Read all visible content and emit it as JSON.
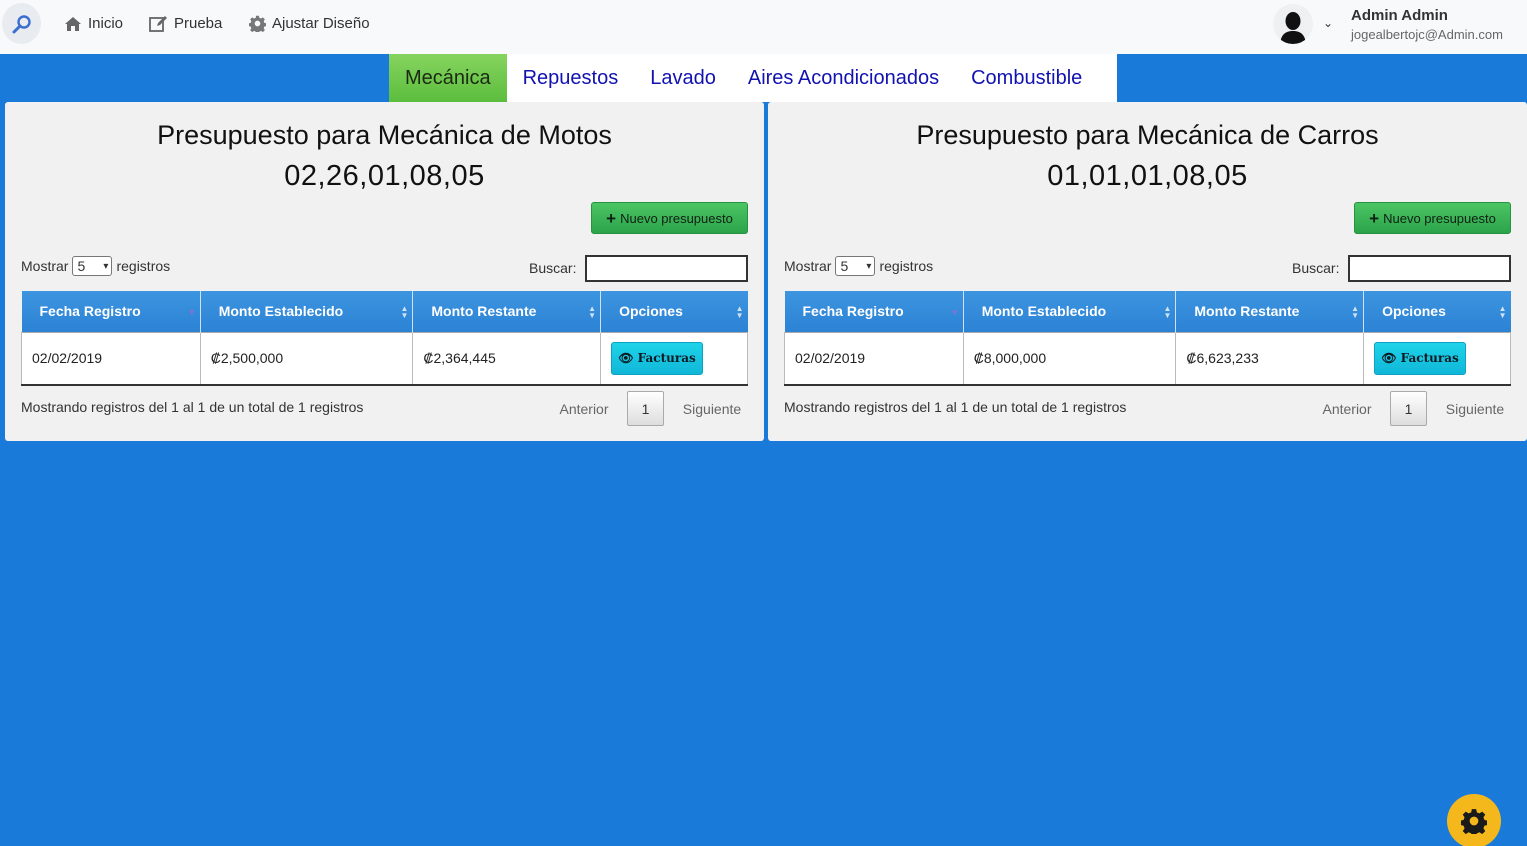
{
  "nav": {
    "items": [
      {
        "label": "Inicio",
        "icon": "home-icon"
      },
      {
        "label": "Prueba",
        "icon": "edit-icon"
      },
      {
        "label": "Ajustar Diseño",
        "icon": "gear-icon"
      }
    ]
  },
  "user": {
    "name": "Admin Admin",
    "email": "jogealbertojc@Admin.com"
  },
  "tabs": [
    {
      "label": "Mecánica",
      "active": true
    },
    {
      "label": "Repuestos",
      "active": false
    },
    {
      "label": "Lavado",
      "active": false
    },
    {
      "label": "Aires Acondicionados",
      "active": false
    },
    {
      "label": "Combustible",
      "active": false
    }
  ],
  "panels": [
    {
      "title": "Presupuesto para Mecánica de Motos",
      "code": "02,26,01,08,05",
      "new_button": "Nuevo presupuesto",
      "show_prefix": "Mostrar",
      "show_value": "5",
      "show_suffix": "registros",
      "search_label": "Buscar:",
      "columns": [
        "Fecha Registro",
        "Monto Establecido",
        "Monto Restante",
        "Opciones"
      ],
      "row": {
        "fecha": "02/02/2019",
        "establecido": "₡2,500,000",
        "restante": "₡2,364,445",
        "button": "Facturas"
      },
      "info": "Mostrando registros del 1 al 1 de un total de 1 registros",
      "pager": {
        "prev": "Anterior",
        "page": "1",
        "next": "Siguiente"
      }
    },
    {
      "title": "Presupuesto para Mecánica de Carros",
      "code": "01,01,01,08,05",
      "new_button": "Nuevo presupuesto",
      "show_prefix": "Mostrar",
      "show_value": "5",
      "show_suffix": "registros",
      "search_label": "Buscar:",
      "columns": [
        "Fecha Registro",
        "Monto Establecido",
        "Monto Restante",
        "Opciones"
      ],
      "row": {
        "fecha": "02/02/2019",
        "establecido": "₡8,000,000",
        "restante": "₡6,623,233",
        "button": "Facturas"
      },
      "info": "Mostrando registros del 1 al 1 de un total de 1 registros",
      "pager": {
        "prev": "Anterior",
        "page": "1",
        "next": "Siguiente"
      }
    }
  ],
  "colors": {
    "background": "#1a7ad9",
    "active_tab": "#6cc84c",
    "header": "#2c82d4",
    "fab": "#f5b81c"
  }
}
